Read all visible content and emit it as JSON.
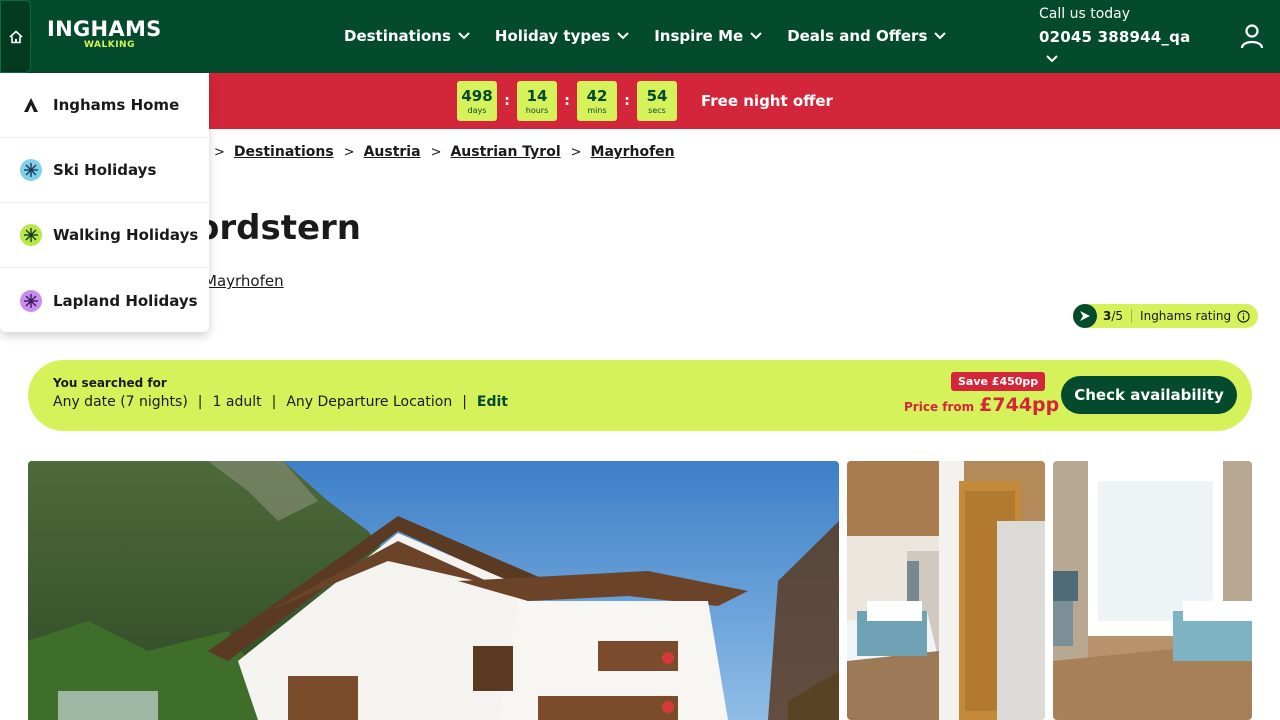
{
  "header": {
    "logo_main": "INGHAMS",
    "logo_sub": "WALKING",
    "nav": [
      {
        "label": "Destinations"
      },
      {
        "label": "Holiday types"
      },
      {
        "label": "Inspire Me"
      },
      {
        "label": "Deals and Offers"
      }
    ],
    "call_label": "Call us today",
    "call_number": "02045 388944_qa",
    "icons": {
      "home": "home-icon",
      "user": "user-icon",
      "chevron": "chevron-down-icon"
    }
  },
  "promo": {
    "countdown": [
      {
        "value": "498",
        "unit": "days"
      },
      {
        "value": "14",
        "unit": "hours"
      },
      {
        "value": "42",
        "unit": "mins"
      },
      {
        "value": "54",
        "unit": "secs"
      }
    ],
    "separator": ":",
    "offer_text": "Free night offer"
  },
  "breadcrumb": [
    "Destinations",
    "Austria",
    "Austrian Tyrol",
    "Mayrhofen"
  ],
  "hotel": {
    "title_visible": "ordstern",
    "location_visible": "Mayrhofen",
    "rating_score": "3",
    "rating_max": "/5",
    "rating_label": "Inghams rating"
  },
  "search": {
    "label": "You searched for",
    "dates": "Any date (7 nights)",
    "travellers": "1 adult",
    "departure": "Any Departure Location",
    "sep": "|",
    "edit": "Edit",
    "save_badge": "Save £450pp",
    "price_label": "Price from",
    "price_value": "£744pp",
    "cta": "Check availability"
  },
  "dropdown": {
    "items": [
      {
        "label": "Inghams Home",
        "icon": "inghams-logo-icon"
      },
      {
        "label": "Ski Holidays",
        "icon": "snowflake-icon"
      },
      {
        "label": "Walking Holidays",
        "icon": "walking-icon"
      },
      {
        "label": "Lapland Holidays",
        "icon": "lapland-icon"
      }
    ]
  },
  "colors": {
    "brand_green": "#044a2c",
    "accent_lime": "#d6f25a",
    "promo_red": "#d4263a"
  }
}
